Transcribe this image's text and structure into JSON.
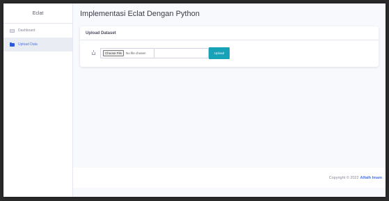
{
  "sidebar": {
    "brand": "Eclat",
    "items": [
      {
        "label": "Dashboard",
        "icon": "dashboard-icon",
        "active": false
      },
      {
        "label": "Upload Data",
        "icon": "folder-icon",
        "active": true
      }
    ]
  },
  "main": {
    "title": "Implementasi Eclat Dengan Python",
    "card": {
      "header": "Upload Dataset",
      "file_button": "Choose File",
      "file_status": "No file chosen",
      "upload_button": "Upload"
    }
  },
  "footer": {
    "copyright": "Copyright © 2022",
    "author": "Alfath Imam"
  },
  "colors": {
    "accent": "#4e73df",
    "upload_button": "#17a2b8",
    "background": "#f8f9fc"
  }
}
